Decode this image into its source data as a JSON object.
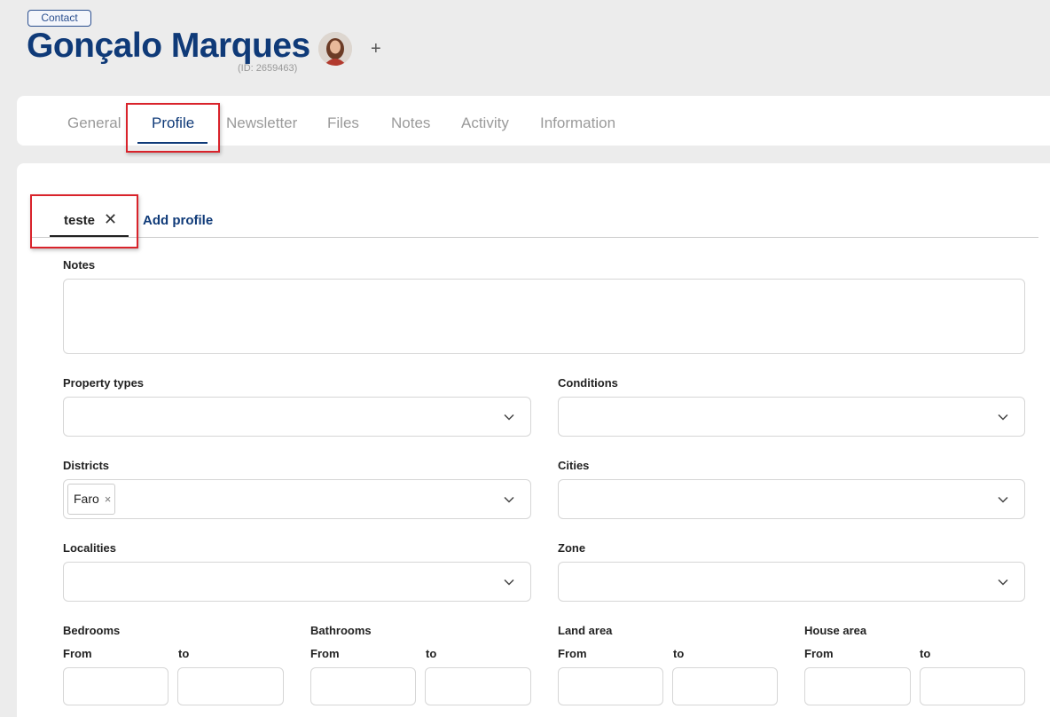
{
  "header": {
    "badge": "Contact",
    "name": "Gonçalo Marques",
    "id_text": "(ID: 2659463)",
    "add_symbol": "+"
  },
  "tabs": [
    {
      "label": "General"
    },
    {
      "label": "Profile"
    },
    {
      "label": "Newsletter"
    },
    {
      "label": "Files"
    },
    {
      "label": "Notes"
    },
    {
      "label": "Activity"
    },
    {
      "label": "Information"
    }
  ],
  "profile": {
    "tab_name": "teste",
    "close_symbol": "✕",
    "add_label": "Add profile"
  },
  "form": {
    "notes_label": "Notes",
    "notes_value": "",
    "property_types_label": "Property types",
    "conditions_label": "Conditions",
    "districts_label": "Districts",
    "districts_selected": "Faro",
    "chip_remove": "×",
    "cities_label": "Cities",
    "localities_label": "Localities",
    "zone_label": "Zone",
    "bedrooms_label": "Bedrooms",
    "bathrooms_label": "Bathrooms",
    "land_area_label": "Land area",
    "house_area_label": "House area",
    "from_label": "From",
    "to_label": "to"
  },
  "colors": {
    "brand": "#0f3a78",
    "highlight": "#d9232b"
  }
}
